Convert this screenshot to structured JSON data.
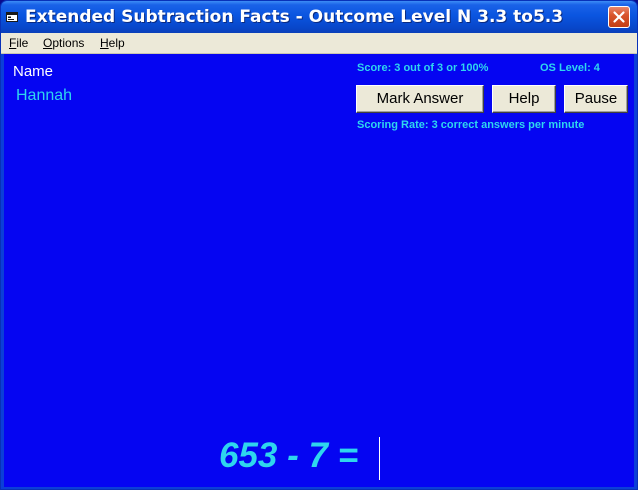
{
  "window": {
    "title": "Extended Subtraction Facts - Outcome Level N 3.3 to5.3",
    "close_icon": "close-x"
  },
  "menu": {
    "file": {
      "accel": "F",
      "rest": "ile"
    },
    "options": {
      "accel": "O",
      "rest": "ptions"
    },
    "help": {
      "accel": "H",
      "rest": "elp"
    }
  },
  "student": {
    "name_label": "Name",
    "name_value": "Hannah"
  },
  "stats": {
    "score": "Score: 3 out of 3 or 100%",
    "os_level": "OS Level: 4",
    "scoring_rate": "Scoring Rate: 3 correct answers per minute"
  },
  "buttons": {
    "mark_answer": "Mark Answer",
    "help": "Help",
    "pause": "Pause"
  },
  "problem": {
    "expression": "653 - 7 =",
    "answer": ""
  },
  "colors": {
    "client_bg": "#0505f2",
    "accent_text": "#2ed6ee"
  }
}
